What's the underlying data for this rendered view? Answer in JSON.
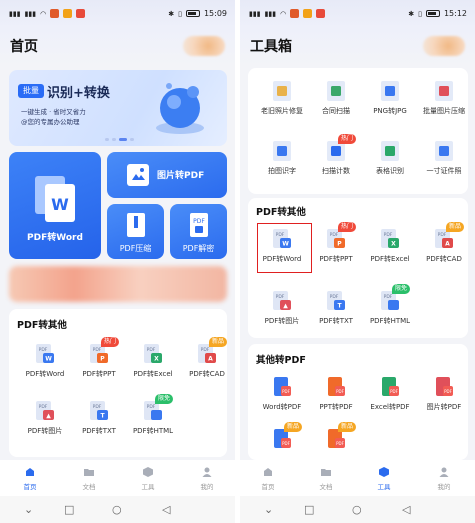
{
  "left": {
    "status": {
      "time": "15:09",
      "battery": 0.8
    },
    "page_title": "首页",
    "banner": {
      "badge": "批量",
      "title": "识别+转换",
      "sub1": "一键生成 · 省时又省力",
      "sub2": "@您的专属办公助理"
    },
    "tiles": {
      "pdf_word": "PDF转Word",
      "img_pdf": "图片转PDF",
      "pdf_compress": "PDF压缩",
      "pdf_decrypt": "PDF解密"
    },
    "card": {
      "title": "PDF转其他",
      "items": [
        {
          "label": "PDF转Word",
          "badge": ""
        },
        {
          "label": "PDF转PPT",
          "badge": "热门"
        },
        {
          "label": "PDF转Excel",
          "badge": ""
        },
        {
          "label": "PDF转CAD",
          "badge": "新品"
        },
        {
          "label": "PDF转图片",
          "badge": ""
        },
        {
          "label": "PDF转TXT",
          "badge": ""
        },
        {
          "label": "PDF转HTML",
          "badge": "限免"
        }
      ]
    },
    "nav": [
      "首页",
      "文档",
      "工具",
      "我的"
    ]
  },
  "right": {
    "status": {
      "time": "15:12",
      "battery": 0.8
    },
    "page_title": "工具箱",
    "tools": {
      "items": [
        {
          "label": "老旧照片修复",
          "badge": ""
        },
        {
          "label": "合同扫描",
          "badge": ""
        },
        {
          "label": "PNG转JPG",
          "badge": ""
        },
        {
          "label": "批量图片压缩",
          "badge": ""
        },
        {
          "label": "拍图识字",
          "badge": ""
        },
        {
          "label": "扫描计数",
          "badge": "热门"
        },
        {
          "label": "表格识别",
          "badge": ""
        },
        {
          "label": "一寸证件照",
          "badge": ""
        }
      ]
    },
    "pdf_other": {
      "title": "PDF转其他",
      "items": [
        {
          "label": "PDF转Word",
          "badge": ""
        },
        {
          "label": "PDF转PPT",
          "badge": "热门"
        },
        {
          "label": "PDF转Excel",
          "badge": ""
        },
        {
          "label": "PDF转CAD",
          "badge": "新品"
        },
        {
          "label": "PDF转图片",
          "badge": ""
        },
        {
          "label": "PDF转TXT",
          "badge": ""
        },
        {
          "label": "PDF转HTML",
          "badge": "限免"
        }
      ]
    },
    "other_pdf": {
      "title": "其他转PDF",
      "items": [
        {
          "label": "Word转PDF",
          "badge": ""
        },
        {
          "label": "PPT转PDF",
          "badge": ""
        },
        {
          "label": "Excel转PDF",
          "badge": ""
        },
        {
          "label": "图片转PDF",
          "badge": ""
        },
        {
          "label": "",
          "badge": "新品"
        },
        {
          "label": "",
          "badge": "新品"
        }
      ]
    },
    "nav": [
      "首页",
      "文档",
      "工具",
      "我的"
    ]
  },
  "icons": {
    "pdf_word": "word-icon",
    "pdf_ppt": "ppt-icon",
    "pdf_excel": "excel-icon",
    "pdf_cad": "cad-icon",
    "pdf_img": "image-icon",
    "pdf_txt": "txt-icon",
    "pdf_html": "html-icon"
  },
  "colors": {
    "accent": "#2b6bee",
    "hot": "#f04a3a",
    "new": "#f5a623",
    "free": "#2bbf6a",
    "highlight": "#e02020"
  }
}
